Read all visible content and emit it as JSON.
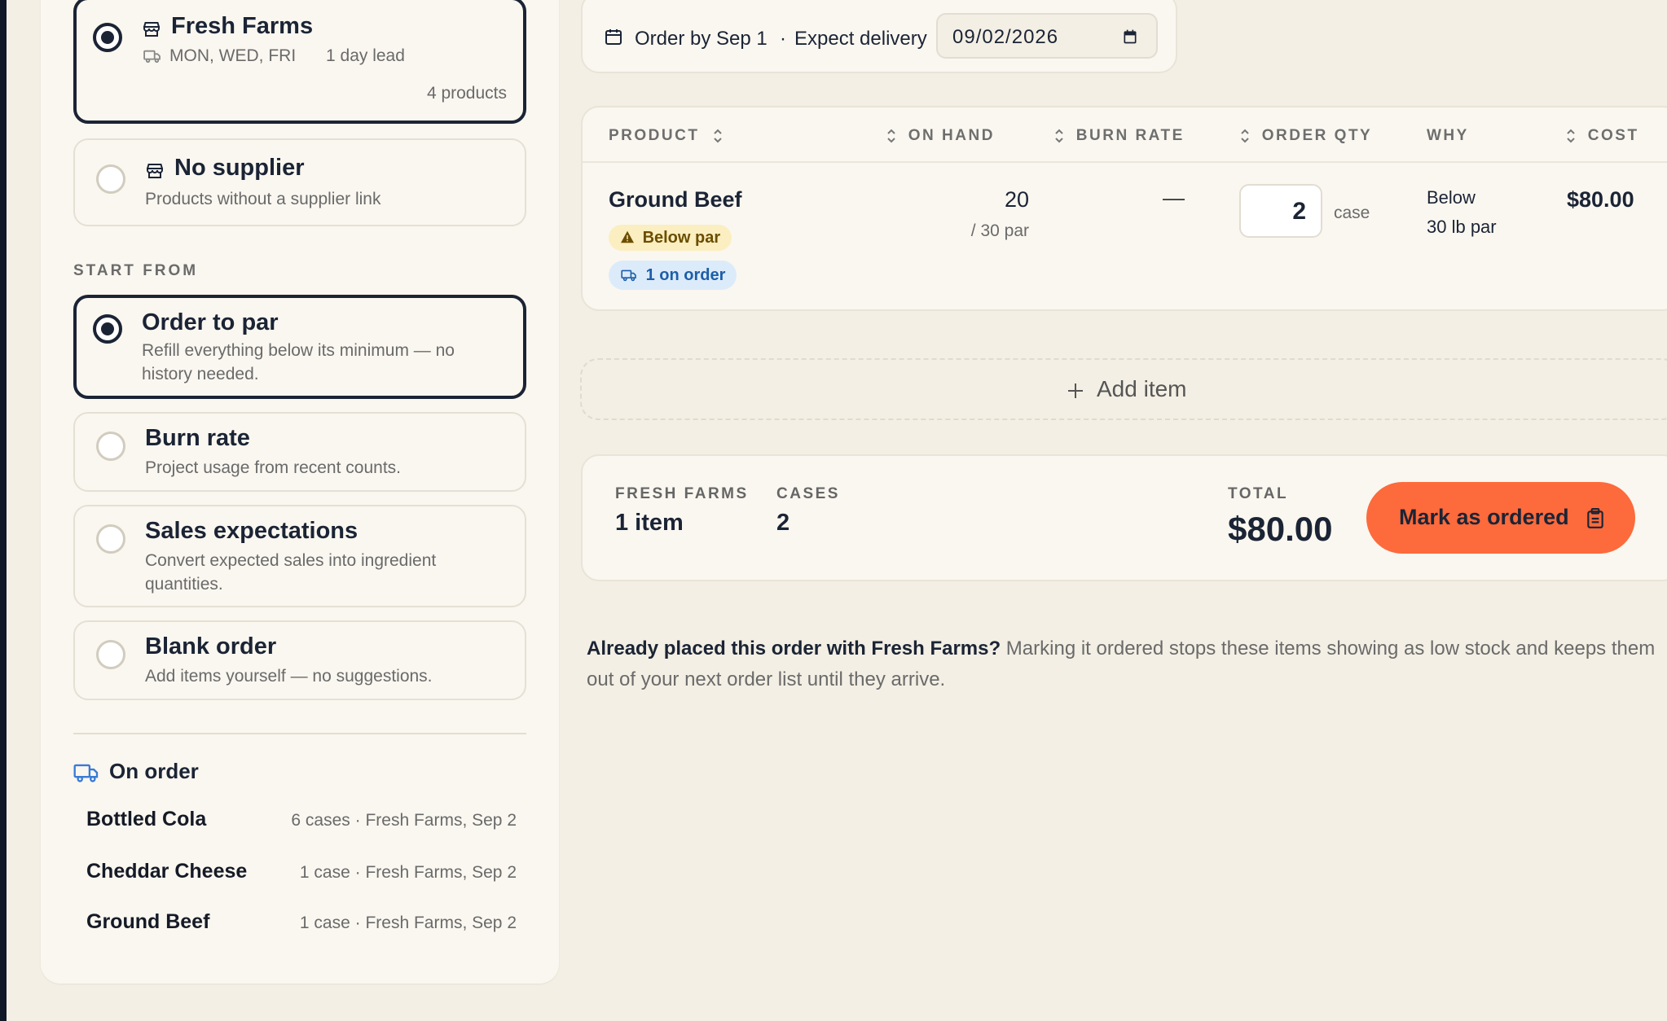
{
  "supplier_options": [
    {
      "title": "Fresh Farms",
      "days": "MON, WED, FRI",
      "lead": "1 day lead",
      "products": "4 products",
      "selected": true
    },
    {
      "title": "No supplier",
      "desc": "Products without a supplier link",
      "selected": false
    }
  ],
  "start_from": {
    "label": "START FROM",
    "options": [
      {
        "title": "Order to par",
        "desc": "Refill everything below its minimum — no history needed.",
        "selected": true
      },
      {
        "title": "Burn rate",
        "desc": "Project usage from recent counts.",
        "selected": false
      },
      {
        "title": "Sales expectations",
        "desc": "Convert expected sales into ingredient quantities.",
        "selected": false
      },
      {
        "title": "Blank order",
        "desc": "Add items yourself — no suggestions.",
        "selected": false
      }
    ]
  },
  "on_order": {
    "title": "On order",
    "items": [
      {
        "name": "Bottled Cola",
        "detail": "6 cases · Fresh Farms, Sep 2"
      },
      {
        "name": "Cheddar Cheese",
        "detail": "1 case · Fresh Farms, Sep 2"
      },
      {
        "name": "Ground Beef",
        "detail": "1 case · Fresh Farms, Sep 2"
      }
    ]
  },
  "delivery": {
    "order_by": "Order by Sep 1",
    "separator": "·",
    "expect_label": "Expect delivery",
    "date_value": "09/02/2026"
  },
  "table": {
    "headers": {
      "product": "PRODUCT",
      "on_hand": "ON HAND",
      "burn_rate": "BURN RATE",
      "order_qty": "ORDER QTY",
      "why": "WHY",
      "cost": "COST"
    },
    "rows": [
      {
        "product": "Ground Beef",
        "badge_warn": "Below par",
        "badge_info": "1 on order",
        "on_hand": "20",
        "par": "/ 30 par",
        "burn_rate": "—",
        "qty": "2",
        "unit": "case",
        "why_line1": "Below",
        "why_line2": "30 lb par",
        "cost": "$80.00"
      }
    ]
  },
  "add_item_label": "Add item",
  "summary": {
    "supplier_label": "FRESH FARMS",
    "supplier_value": "1 item",
    "cases_label": "CASES",
    "cases_value": "2",
    "total_label": "TOTAL",
    "total_value": "$80.00",
    "button_label": "Mark as ordered"
  },
  "note": {
    "bold": "Already placed this order with Fresh Farms?",
    "rest": " Marking it ordered stops these items showing as low stock and keeps them out of your next order list until they arrive."
  },
  "colors": {
    "accent": "#fd6a3c",
    "navy": "#1b2435",
    "warn_bg": "#fbeec0",
    "info_bg": "#dcebfa"
  }
}
